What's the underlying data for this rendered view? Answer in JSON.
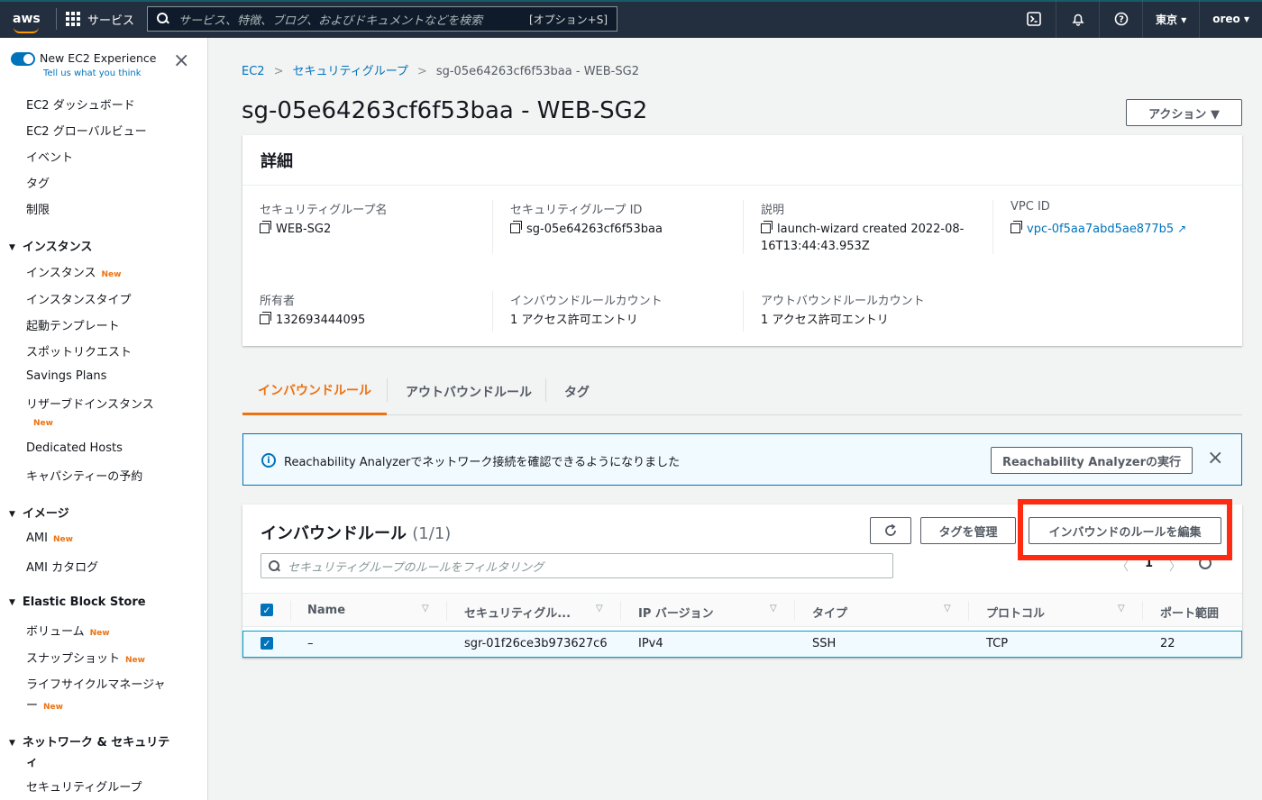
{
  "topnav": {
    "logo": "aws",
    "services_label": "サービス",
    "search_placeholder": "サービス、特徴、ブログ、およびドキュメントなどを検索",
    "search_shortcut": "[オプション+S]",
    "region": "東京 ▾",
    "user": "oreo ▾",
    "icons": [
      "cloudshell-icon",
      "bell-icon",
      "help-icon"
    ]
  },
  "sidebar": {
    "experience_title": "New EC2 Experience",
    "experience_sub": "Tell us what you think",
    "items": [
      {
        "label": "EC2 ダッシュボード"
      },
      {
        "label": "EC2 グローバルビュー"
      },
      {
        "label": "イベント"
      },
      {
        "label": "タグ"
      },
      {
        "label": "制限"
      }
    ],
    "sections": [
      {
        "title": "インスタンス",
        "items": [
          "インスタンス",
          "インスタンスタイプ",
          "起動テンプレート",
          "スポットリクエスト",
          "Savings Plans",
          "リザーブドインスタンス",
          "Dedicated Hosts",
          "キャパシティーの予約"
        ]
      },
      {
        "title": "イメージ",
        "items": [
          "AMI",
          "AMI カタログ"
        ]
      },
      {
        "title": "Elastic Block Store",
        "items": [
          "ボリューム",
          "スナップショット",
          "ライフサイクルマネージャ",
          "ー"
        ]
      },
      {
        "title": "ネットワーク & セキュリテ",
        "title2": "ィ",
        "items": [
          "セキュリティグループ"
        ]
      }
    ],
    "new_badge": "New"
  },
  "breadcrumb": {
    "items": [
      "EC2",
      "セキュリティグループ",
      "sg-05e64263cf6f53baa - WEB-SG2"
    ],
    "sep": ">"
  },
  "page_title": "sg-05e64263cf6f53baa - WEB-SG2",
  "action_button": "アクション ▼",
  "details": {
    "title": "詳細",
    "fields": [
      {
        "label": "セキュリティグループ名",
        "value": "WEB-SG2"
      },
      {
        "label": "セキュリティグループ ID",
        "value": "sg-05e64263cf6f53baa"
      },
      {
        "label": "説明",
        "value": "launch-wizard created 2022-08-16T13:44:43.953Z",
        "value_line1": "launch-wizard created 2022-08-",
        "value_line2": "16T13:44:43.953Z"
      },
      {
        "label": "VPC ID",
        "value": "vpc-0f5aa7abd5ae877b5"
      },
      {
        "label": "所有者",
        "value": "132693444095"
      },
      {
        "label": "インバウンドルールカウント",
        "value": "1 アクセス許可エントリ"
      },
      {
        "label": "アウトバウンドルールカウント",
        "value": "1 アクセス許可エントリ"
      }
    ]
  },
  "tabs": [
    "インバウンドルール",
    "アウトバウンドルール",
    "タグ"
  ],
  "alert": {
    "text": "Reachability Analyzerでネットワーク接続を確認できるようになりました",
    "button": "Reachability Analyzerの実行"
  },
  "rules": {
    "title": "インバウンドルール",
    "count": "(1/1)",
    "manage_tags": "タグを管理",
    "edit_button": "インバウンドのルールを編集",
    "filter_placeholder": "セキュリティグループのルールをフィルタリング",
    "page": "1",
    "columns": [
      "Name",
      "セキュリティグル...",
      "IP バージョン",
      "タイプ",
      "プロトコル",
      "ポート範囲"
    ],
    "rows": [
      {
        "name": "–",
        "sgr": "sgr-01f26ce3b973627c6",
        "ip": "IPv4",
        "type": "SSH",
        "protocol": "TCP",
        "port": "22"
      }
    ]
  },
  "colors": {
    "nav_bg": "#232f3e",
    "link": "#0073bb",
    "accent": "#ec7211",
    "highlight": "#ff2a12"
  }
}
